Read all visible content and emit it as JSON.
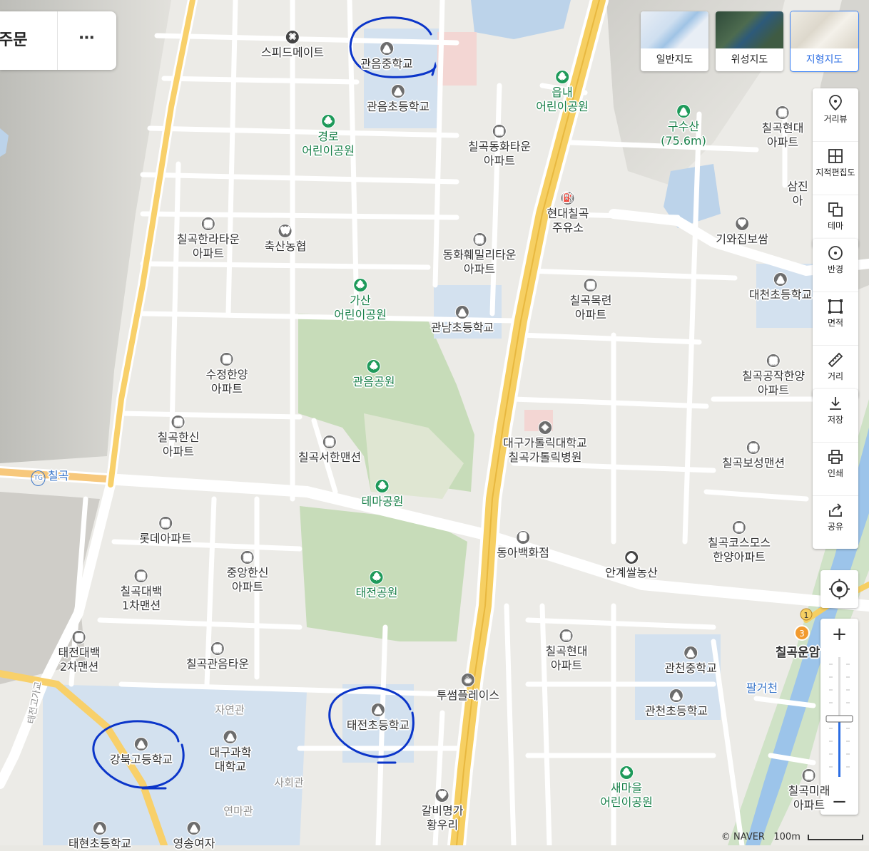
{
  "top_card": {
    "title": "주문",
    "more": "⋯"
  },
  "map_types": [
    {
      "label": "일반지도",
      "active": false
    },
    {
      "label": "위성지도",
      "active": false
    },
    {
      "label": "지형지도",
      "active": true
    }
  ],
  "tools_group1": [
    {
      "label": "거리뷰",
      "icon": "pin-outline-icon"
    },
    {
      "label": "지적편집도",
      "icon": "grid-icon"
    },
    {
      "label": "테마",
      "icon": "layers-icon"
    }
  ],
  "tools_group2": [
    {
      "label": "반경",
      "icon": "radius-icon"
    },
    {
      "label": "면적",
      "icon": "area-icon"
    },
    {
      "label": "거리",
      "icon": "ruler-icon"
    }
  ],
  "tools_group3": [
    {
      "label": "저장",
      "icon": "download-icon"
    },
    {
      "label": "인쇄",
      "icon": "printer-icon"
    },
    {
      "label": "공유",
      "icon": "share-icon"
    }
  ],
  "zoom": {
    "plus": "+",
    "minus": "−"
  },
  "footer": {
    "copyright": "© NAVER",
    "scale": "100m"
  },
  "labels": {
    "speedmate": "스피드메이트",
    "gwaneum_mid": "관음중학교",
    "gwaneum_elem": "관음초등학교",
    "gyeongro_park": "경로\n어린이공원",
    "eupnae_park": "읍내\n어린이공원",
    "chilgok_dongwha": "칠곡동화타운\n아파트",
    "gusu_mountain": "구수산\n(75.6m)",
    "chilgok_hyundai_top": "칠곡현대\n아파트",
    "samjin": "삼진\n아",
    "hyundai_gas": "현대칠곡\n주유소",
    "giwajip": "기와집보쌈",
    "chilgok_hanra": "칠곡한라타운\n아파트",
    "chuksan": "축산농협",
    "dongwha_family": "동화훼밀리타운\n아파트",
    "gasan_park": "가산\n어린이공원",
    "gwannam_elem": "관남초등학교",
    "chilgok_mokryeon": "칠곡목련\n아파트",
    "daecheon_elem": "대천초등학교",
    "gwaneum_park": "관음공원",
    "sujeong_hanyang": "수정한양\n아파트",
    "chilgok_gongjak": "칠곡공작한양\n아파트",
    "chilgok_hanshin": "칠곡한신\n아파트",
    "chilgok_seohan": "칠곡서한맨션",
    "catholic_hospital": "대구가톨릭대학교\n칠곡가톨릭병원",
    "chilgok_boseong": "칠곡보성맨션",
    "tg_chilgok": "칠곡",
    "tema_park": "테마공원",
    "lotte_apt": "롯데아파트",
    "donga_dept": "동아백화점",
    "angye_rice": "안계쌀농산",
    "chilgok_cosmos": "칠곡코스모스\n한양아파트",
    "jungang_hanshin": "중앙한신\n아파트",
    "chilgok_daebaek1": "칠곡대백\n1차맨션",
    "taejeon_park": "태전공원",
    "taejeon_daebaek2": "태전대백\n2차맨션",
    "chilgok_gwaneum_town": "칠곡관음타운",
    "chilgok_hyundai_low": "칠곡현대\n아파트",
    "gwancheon_mid": "관천중학교",
    "chilgok_unam": "칠곡운암",
    "twosome": "투썸플레이스",
    "taejeon_gyo": "태전고가교",
    "jayeon_hall": "자연관",
    "palgeo_stream": "팔거천",
    "gwancheon_elem": "관천초등학교",
    "taejeon_elem": "태전초등학교",
    "gangbuk_high": "강북고등학교",
    "daegu_science": "대구과학\n대학교",
    "sahoe_hall": "사회관",
    "saemaeul_park": "새마을\n어린이공원",
    "chilgok_mirae": "칠곡미래\n아파트",
    "yeonma_hall": "연마관",
    "galbi": "갈비명가\n황우리",
    "taehyeon_elem": "태현초등학교",
    "youngsong": "영송여자"
  }
}
